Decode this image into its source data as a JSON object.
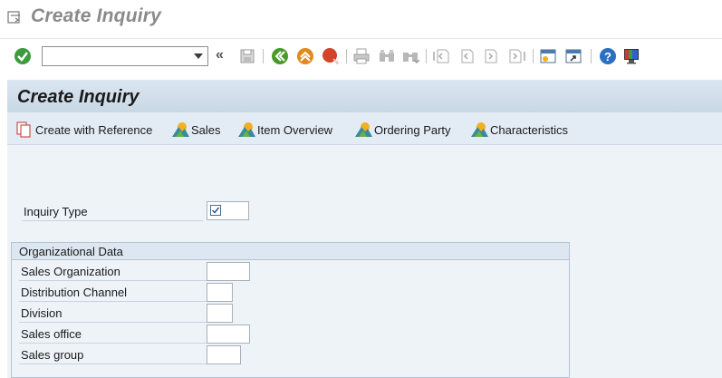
{
  "window": {
    "title": "Create Inquiry"
  },
  "toolbar": {
    "command_field_value": "",
    "icons": [
      "enter-icon",
      "save-icon",
      "back-icon",
      "exit-icon",
      "cancel-icon",
      "print-icon",
      "find-icon",
      "find-next-icon",
      "first-page-icon",
      "previous-page-icon",
      "next-page-icon",
      "last-page-icon",
      "create-session-icon",
      "shortcut-icon",
      "help-icon",
      "layout-icon"
    ]
  },
  "screen": {
    "title": "Create Inquiry",
    "actions": [
      {
        "label": "Create with Reference",
        "icon": "reference-icon"
      },
      {
        "label": "Sales",
        "icon": "mountain-icon"
      },
      {
        "label": "Item Overview",
        "icon": "mountain-icon"
      },
      {
        "label": "Ordering Party",
        "icon": "mountain-icon"
      },
      {
        "label": "Characteristics",
        "icon": "mountain-icon"
      }
    ]
  },
  "form": {
    "inquiry_type": {
      "label": "Inquiry Type",
      "value": ""
    },
    "org_group": {
      "title": "Organizational Data",
      "fields": [
        {
          "label": "Sales Organization",
          "value": ""
        },
        {
          "label": "Distribution Channel",
          "value": ""
        },
        {
          "label": "Division",
          "value": ""
        },
        {
          "label": "Sales office",
          "value": ""
        },
        {
          "label": "Sales group",
          "value": ""
        }
      ]
    }
  },
  "colors": {
    "enter": "#3d9a3d",
    "back": "#4a9a2a",
    "exit": "#e08a1a",
    "cancel": "#d4442a",
    "help": "#2a70c0"
  }
}
